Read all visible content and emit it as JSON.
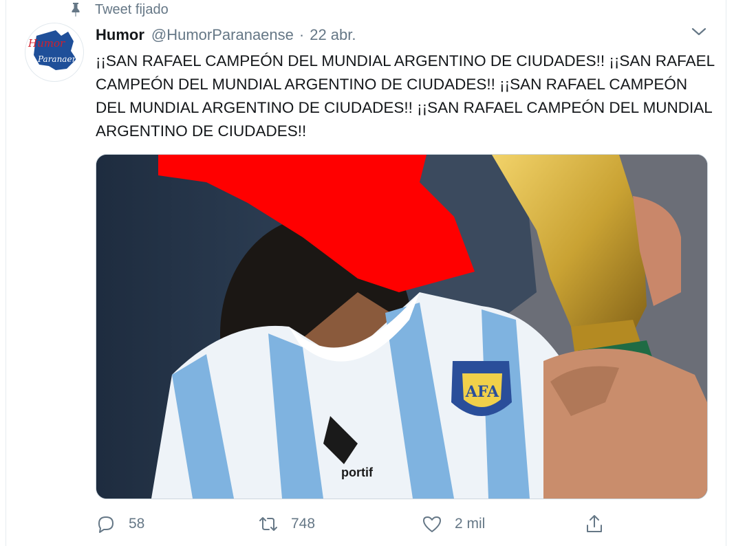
{
  "pinned": {
    "label": "Tweet fijado",
    "icon": "pin-icon"
  },
  "tweet": {
    "author_name": "Humor",
    "handle": "@HumorParanaense",
    "separator": "·",
    "date": "22 abr.",
    "text": "¡¡SAN RAFAEL CAMPEÓN DEL MUNDIAL ARGENTINO DE CIUDADES!! ¡¡SAN RAFAEL CAMPEÓN DEL MUNDIAL ARGENTINO DE CIUDADES!! ¡¡SAN RAFAEL CAMPEÓN DEL MUNDIAL ARGENTINO DE CIUDADES!! ¡¡SAN RAFAEL CAMPEÓN DEL MUNDIAL ARGENTINO DE CIUDADES!!",
    "avatar_logo_text": [
      "Humor",
      "Paranaense"
    ],
    "media_jersey_text": [
      "AFA",
      "portif"
    ]
  },
  "actions": {
    "replies": "58",
    "retweets": "748",
    "likes": "2 mil"
  },
  "colors": {
    "text": "#14171a",
    "secondary": "#657786",
    "border": "#e6ecf0",
    "censor_red": "#ff0000",
    "jersey_blue": "#6fa8dc",
    "trophy_gold": "#c9a233"
  },
  "icons": [
    "pin-icon",
    "chevron-down-icon",
    "reply-icon",
    "retweet-icon",
    "like-icon",
    "share-icon"
  ]
}
